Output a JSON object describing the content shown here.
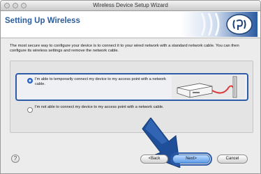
{
  "window": {
    "title": "Wireless Device Setup Wizard"
  },
  "header": {
    "title": "Setting Up Wireless"
  },
  "intro": {
    "text": "The most secure way to configure your device is to connect it to your wired network with a standard network cable. You can then configure its wireless settings and remove the network cable."
  },
  "options": [
    {
      "label": "I'm able to temporarily connect my device to my access point with a network cable.",
      "selected": true
    },
    {
      "label": "I'm not able to connect my device to my access point with a network cable.",
      "selected": false
    }
  ],
  "buttons": {
    "help": "?",
    "back": "<Back",
    "next": "Next>",
    "cancel": "Cancel"
  },
  "colors": {
    "accent": "#2d5ba8",
    "title_text": "#2a5d9f",
    "arrow": "#1f4f99",
    "cable": "#d83c3c"
  },
  "icons": {
    "logo": "wifi-logo-icon",
    "device": "printer-router-cable-icon",
    "arrow": "down-right-arrow-icon"
  }
}
